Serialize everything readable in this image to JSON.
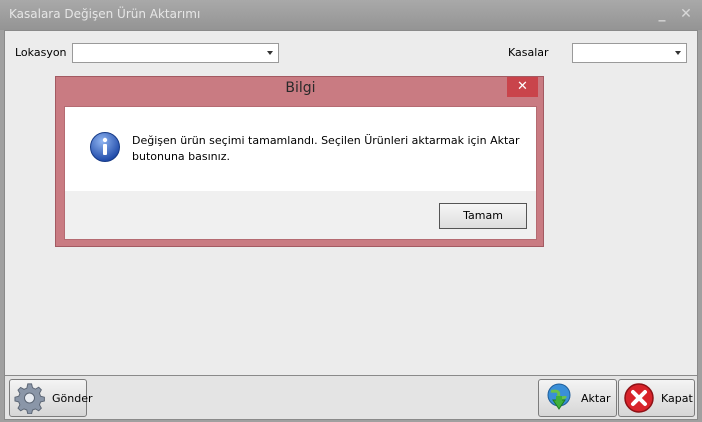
{
  "window": {
    "title": "Kasalara Değişen Ürün Aktarımı",
    "minimize_glyph": "_",
    "close_glyph": "✕"
  },
  "filters": {
    "lokasyon_label": "Lokasyon",
    "lokasyon_value": "",
    "kasalar_label": "Kasalar",
    "kasalar_value": ""
  },
  "toolbar": {
    "gonder_label": "Gönder",
    "gonder_icon": "gear-icon",
    "aktar_label": "Aktar",
    "aktar_icon": "globe-download-icon",
    "kapat_label": "Kapat",
    "kapat_icon": "close-circle-icon"
  },
  "dialog": {
    "title": "Bilgi",
    "close_glyph": "✕",
    "icon": "info-icon",
    "message_line1": "Değişen ürün seçimi tamamlandı. Seçilen Ürünleri aktarmak için Aktar",
    "message_line2": "butonuna basınız.",
    "ok_label": "Tamam"
  },
  "colors": {
    "dialog_frame": "#c97b82",
    "dialog_close": "#c9444b",
    "info_blue": "#2f5fb8"
  }
}
